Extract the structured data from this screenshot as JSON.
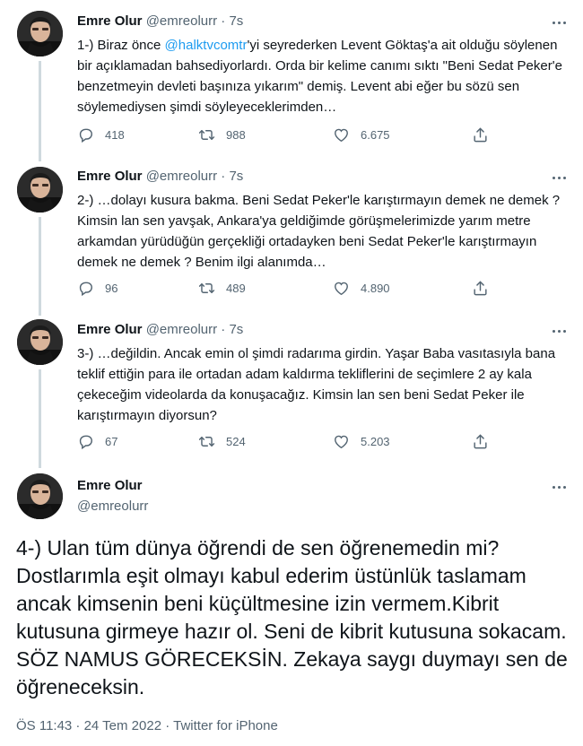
{
  "tweets": [
    {
      "name": "Emre Olur",
      "handle": "@emreolurr",
      "sep": "·",
      "time": "7s",
      "text_before": "1-) Biraz önce ",
      "mention": "@halktvcomtr",
      "text_after": "'yi seyrederken Levent Göktaş'a ait olduğu söylenen bir açıklamadan bahsediyorlardı. Orda bir kelime canımı sıktı \"Beni Sedat Peker'e benzetmeyin devleti başınıza yıkarım\" demiş. Levent abi eğer bu sözü sen söylemediysen şimdi söyleyeceklerimden…",
      "replies": "418",
      "retweets": "988",
      "likes": "6.675"
    },
    {
      "name": "Emre Olur",
      "handle": "@emreolurr",
      "sep": "·",
      "time": "7s",
      "text": "2-) …dolayı kusura bakma. Beni Sedat Peker'le karıştırmayın demek ne demek ? Kimsin lan sen yavşak, Ankara'ya geldiğimde görüşmelerimizde yarım metre arkamdan yürüdüğün gerçekliği ortadayken beni Sedat Peker'le karıştırmayın demek ne demek ? Benim ilgi alanımda…",
      "replies": "96",
      "retweets": "489",
      "likes": "4.890"
    },
    {
      "name": "Emre Olur",
      "handle": "@emreolurr",
      "sep": "·",
      "time": "7s",
      "text": "3-) …değildin. Ancak emin ol şimdi radarıma girdin. Yaşar Baba vasıtasıyla bana teklif ettiğin para ile ortadan adam kaldırma tekliflerini de seçimlere 2 ay kala çekeceğim videolarda da konuşacağız. Kimsin lan sen beni Sedat Peker ile karıştırmayın diyorsun?",
      "replies": "67",
      "retweets": "524",
      "likes": "5.203"
    }
  ],
  "main_tweet": {
    "name": "Emre Olur",
    "handle": "@emreolurr",
    "text": "4-) Ulan tüm dünya öğrendi de sen öğrenemedin mi? Dostlarımla eşit olmayı kabul ederim üstünlük taslamam ancak kimsenin beni küçültmesine izin vermem.Kibrit kutusuna girmeye hazır ol. Seni de kibrit kutusuna sokacam. SÖZ NAMUS GÖRECEKSİN. Zekaya saygı duymayı sen de öğreneceksin.",
    "timestamp": "ÖS 11:43 · 24 Tem 2022 · Twitter for iPhone"
  },
  "icons": {
    "reply": "reply-icon",
    "retweet": "retweet-icon",
    "like": "heart-icon",
    "share": "share-icon",
    "more": "more-icon"
  },
  "colors": {
    "link": "#1d9bf0",
    "secondary": "#536471",
    "thread_line": "#cfd9de"
  }
}
